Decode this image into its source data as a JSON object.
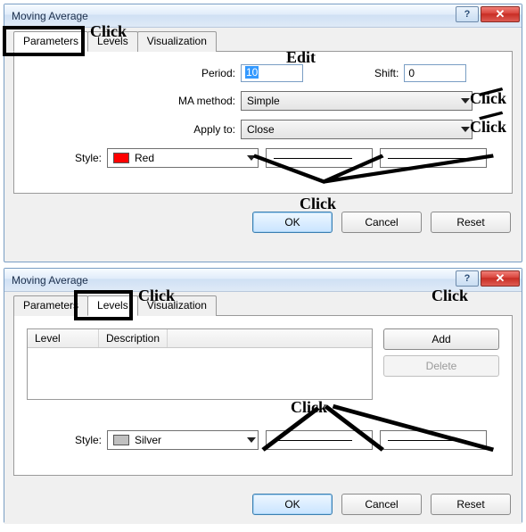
{
  "dialog1": {
    "title": "Moving Average",
    "tabs": {
      "parameters": "Parameters",
      "levels": "Levels",
      "visualization": "Visualization"
    },
    "labels": {
      "period": "Period:",
      "shift": "Shift:",
      "ma_method": "MA method:",
      "apply_to": "Apply to:",
      "style": "Style:"
    },
    "values": {
      "period": "10",
      "shift": "0",
      "ma_method": "Simple",
      "apply_to": "Close",
      "color_name": "Red",
      "color_hex": "#ff0000"
    },
    "buttons": {
      "ok": "OK",
      "cancel": "Cancel",
      "reset": "Reset"
    },
    "annotations": {
      "click_tab": "Click",
      "edit": "Edit",
      "click_ma": "Click",
      "click_apply": "Click",
      "click_style": "Click"
    }
  },
  "dialog2": {
    "title": "Moving Average",
    "tabs": {
      "parameters": "Parameters",
      "levels": "Levels",
      "visualization": "Visualization"
    },
    "table": {
      "col_level": "Level",
      "col_description": "Description"
    },
    "side": {
      "add": "Add",
      "delete": "Delete"
    },
    "labels": {
      "style": "Style:"
    },
    "values": {
      "color_name": "Silver",
      "color_hex": "#c0c0c0"
    },
    "buttons": {
      "ok": "OK",
      "cancel": "Cancel",
      "reset": "Reset"
    },
    "annotations": {
      "click_tab": "Click",
      "click_add": "Click",
      "click_style": "Click"
    }
  }
}
